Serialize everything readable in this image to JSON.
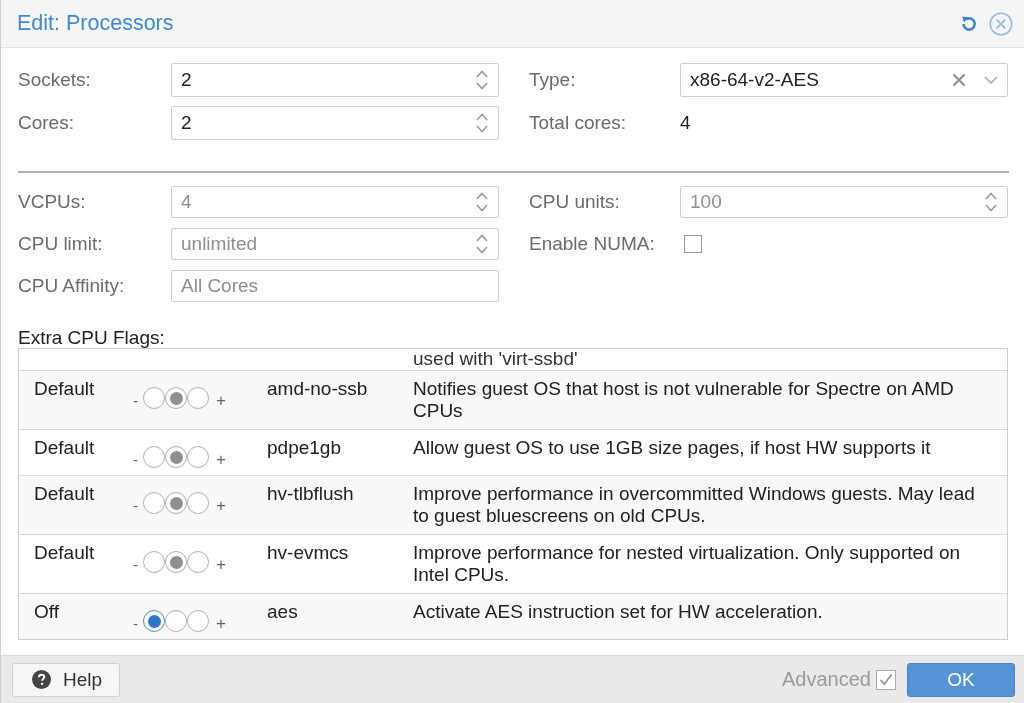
{
  "dialog": {
    "title": "Edit: Processors"
  },
  "general": {
    "left": [
      {
        "kind": "spinner",
        "label": "Sockets:",
        "value": "2"
      },
      {
        "kind": "spinner",
        "label": "Cores:",
        "value": "2"
      }
    ],
    "right": [
      {
        "kind": "combo",
        "label": "Type:",
        "value": "x86-64-v2-AES"
      },
      {
        "kind": "display",
        "label": "Total cores:",
        "value": "4"
      }
    ]
  },
  "advanced": {
    "left": [
      {
        "kind": "spinner",
        "label": "VCPUs:",
        "placeholder": "4"
      },
      {
        "kind": "spinner",
        "label": "CPU limit:",
        "placeholder": "unlimited"
      },
      {
        "kind": "text",
        "label": "CPU Affinity:",
        "placeholder": "All Cores"
      }
    ],
    "right": [
      {
        "kind": "spinner",
        "label": "CPU units:",
        "placeholder": "100"
      },
      {
        "kind": "checkbox",
        "label": "Enable NUMA:",
        "checked": false
      }
    ]
  },
  "cpu_flags": {
    "label": "Extra CPU Flags:",
    "clipped_row": {
      "description": "used with 'virt-ssbd'"
    },
    "rows": [
      {
        "state": "Default",
        "minus": "-",
        "plus": "+",
        "options": [
          {
            "selected": false
          },
          {
            "selected": true
          },
          {
            "selected": false
          }
        ],
        "flag": "amd-no-ssb",
        "description": "Notifies guest OS that host is not vulnerable for Spectre on AMD CPUs"
      },
      {
        "state": "Default",
        "minus": "-",
        "plus": "+",
        "options": [
          {
            "selected": false
          },
          {
            "selected": true
          },
          {
            "selected": false
          }
        ],
        "flag": "pdpe1gb",
        "description": "Allow guest OS to use 1GB size pages, if host HW supports it"
      },
      {
        "state": "Default",
        "minus": "-",
        "plus": "+",
        "options": [
          {
            "selected": false
          },
          {
            "selected": true
          },
          {
            "selected": false
          }
        ],
        "flag": "hv-tlbflush",
        "description": "Improve performance in overcommitted Windows guests. May lead to guest bluescreens on old CPUs."
      },
      {
        "state": "Default",
        "minus": "-",
        "plus": "+",
        "options": [
          {
            "selected": false
          },
          {
            "selected": true
          },
          {
            "selected": false
          }
        ],
        "flag": "hv-evmcs",
        "description": "Improve performance for nested virtualization. Only supported on Intel CPUs."
      },
      {
        "state": "Off",
        "minus": "-",
        "plus": "+",
        "options": [
          {
            "selected": true
          },
          {
            "selected": false
          },
          {
            "selected": false
          }
        ],
        "flag": "aes",
        "description": "Activate AES instruction set for HW acceleration."
      }
    ]
  },
  "footer": {
    "help_button": "Help",
    "advanced": {
      "label": "Advanced",
      "checked": true
    },
    "ok_button": "OK"
  }
}
